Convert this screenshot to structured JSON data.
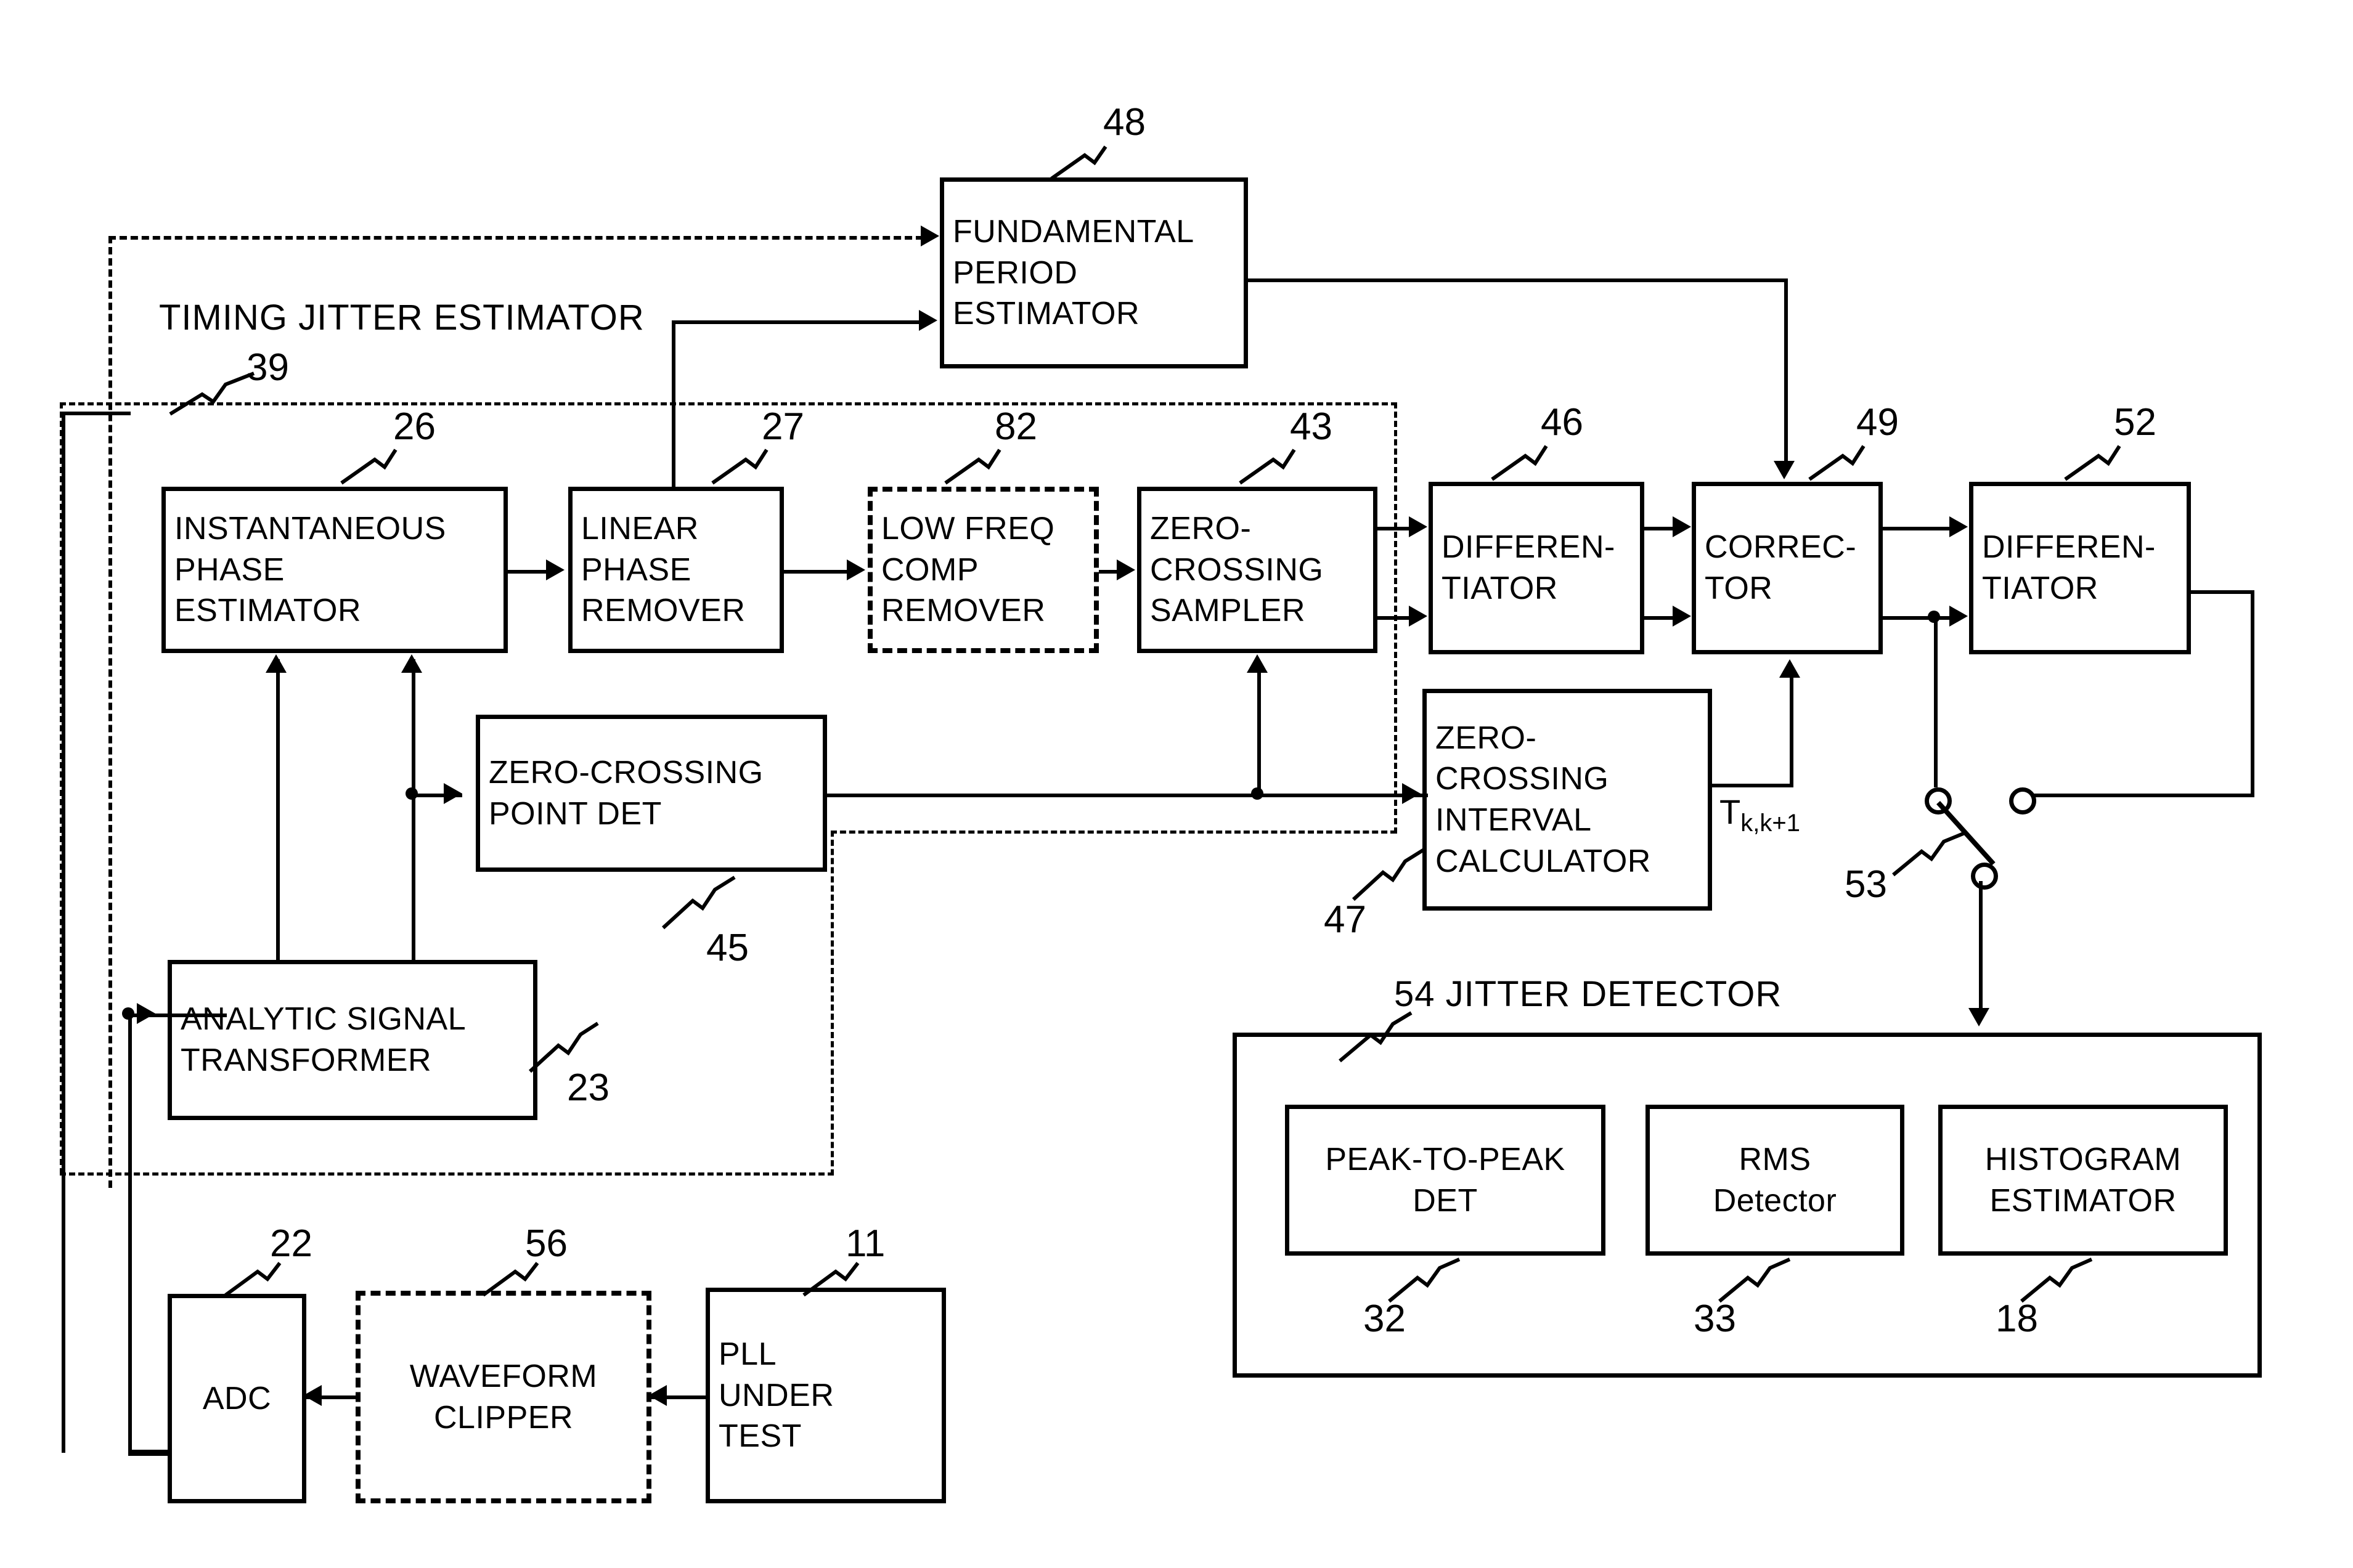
{
  "figure": {
    "type": "block-diagram",
    "domain": "patent-figure",
    "group_labels": {
      "timing_jitter_estimator": "TIMING JITTER ESTIMATOR",
      "timing_jitter_estimator_ref": "39",
      "jitter_detector": "54 JITTER DETECTOR"
    },
    "signal_labels": {
      "interval": "T",
      "interval_sub": "k,k+1"
    }
  },
  "blocks": [
    {
      "id": "fundamental_period_estimator",
      "ref": "48",
      "lines": [
        "FUNDAMENTAL",
        "PERIOD",
        "ESTIMATOR"
      ],
      "style": "solid"
    },
    {
      "id": "instantaneous_phase_estimator",
      "ref": "26",
      "lines": [
        "INSTANTANEOUS",
        "PHASE",
        "ESTIMATOR"
      ],
      "style": "solid"
    },
    {
      "id": "linear_phase_remover",
      "ref": "27",
      "lines": [
        "LINEAR",
        "PHASE",
        "REMOVER"
      ],
      "style": "solid"
    },
    {
      "id": "low_freq_comp_remover",
      "ref": "82",
      "lines": [
        "LOW FREQ",
        "COMP",
        "REMOVER"
      ],
      "style": "dashed"
    },
    {
      "id": "zero_crossing_sampler",
      "ref": "43",
      "lines": [
        "ZERO-",
        "CROSSING",
        "SAMPLER"
      ],
      "style": "solid"
    },
    {
      "id": "differentiator_46",
      "ref": "46",
      "lines": [
        "DIFFEREN-",
        "TIATOR"
      ],
      "style": "solid"
    },
    {
      "id": "corrector",
      "ref": "49",
      "lines": [
        "CORREC-",
        "TOR"
      ],
      "style": "solid"
    },
    {
      "id": "differentiator_52",
      "ref": "52",
      "lines": [
        "DIFFEREN-",
        "TIATOR"
      ],
      "style": "solid"
    },
    {
      "id": "zero_crossing_point_det",
      "ref": "45",
      "lines": [
        "ZERO-CROSSING",
        "POINT DET"
      ],
      "style": "solid"
    },
    {
      "id": "zero_crossing_interval_calculator",
      "ref": "47",
      "lines": [
        "ZERO-",
        "CROSSING",
        "INTERVAL",
        "CALCULATOR"
      ],
      "style": "solid"
    },
    {
      "id": "analytic_signal_transformer",
      "ref": "23",
      "lines": [
        "ANALYTIC SIGNAL",
        "TRANSFORMER"
      ],
      "style": "solid"
    },
    {
      "id": "adc",
      "ref": "22",
      "lines": [
        "ADC"
      ],
      "style": "solid"
    },
    {
      "id": "waveform_clipper",
      "ref": "56",
      "lines": [
        "WAVEFORM",
        "CLIPPER"
      ],
      "style": "dashed"
    },
    {
      "id": "pll_under_test",
      "ref": "11",
      "lines": [
        "PLL",
        "UNDER",
        "TEST"
      ],
      "style": "solid"
    },
    {
      "id": "peak_to_peak_det",
      "ref": "32",
      "lines": [
        "PEAK-TO-PEAK",
        "DET"
      ],
      "style": "solid"
    },
    {
      "id": "rms_detector",
      "ref": "33",
      "lines": [
        "RMS",
        "Detector"
      ],
      "style": "solid"
    },
    {
      "id": "histogram_estimator",
      "ref": "18",
      "lines": [
        "HISTOGRAM",
        "ESTIMATOR"
      ],
      "style": "solid"
    }
  ],
  "refs": {
    "switch": "53"
  },
  "text": {
    "b48_l1": "FUNDAMENTAL",
    "b48_l2": "PERIOD",
    "b48_l3": "ESTIMATOR",
    "b26_l1": "INSTANTANEOUS",
    "b26_l2": "PHASE",
    "b26_l3": "ESTIMATOR",
    "b27_l1": "LINEAR",
    "b27_l2": "PHASE",
    "b27_l3": "REMOVER",
    "b82_l1": "LOW FREQ",
    "b82_l2": "COMP",
    "b82_l3": "REMOVER",
    "b43_l1": "ZERO-",
    "b43_l2": "CROSSING",
    "b43_l3": "SAMPLER",
    "b46_l1": "DIFFEREN-",
    "b46_l2": "TIATOR",
    "b49_l1": "CORREC-",
    "b49_l2": "TOR",
    "b52_l1": "DIFFEREN-",
    "b52_l2": "TIATOR",
    "b45_l1": "ZERO-CROSSING",
    "b45_l2": "POINT DET",
    "b47_l1": "ZERO-",
    "b47_l2": "CROSSING",
    "b47_l3": "INTERVAL",
    "b47_l4": "CALCULATOR",
    "b23_l1": "ANALYTIC SIGNAL",
    "b23_l2": "TRANSFORMER",
    "b22_l1": "ADC",
    "b56_l1": "WAVEFORM",
    "b56_l2": "CLIPPER",
    "b11_l1": "PLL",
    "b11_l2": "UNDER",
    "b11_l3": "TEST",
    "b32_l1": "PEAK-TO-PEAK",
    "b32_l2": "DET",
    "b33_l1": "RMS",
    "b33_l2": "Detector",
    "b18_l1": "HISTOGRAM",
    "b18_l2": "ESTIMATOR",
    "r48": "48",
    "r26": "26",
    "r27": "27",
    "r82": "82",
    "r43": "43",
    "r46": "46",
    "r49": "49",
    "r52": "52",
    "r45": "45",
    "r47": "47",
    "r23": "23",
    "r22": "22",
    "r56": "56",
    "r11": "11",
    "r32": "32",
    "r33": "33",
    "r18": "18",
    "r53": "53",
    "r39": "39",
    "tje_title": "TIMING JITTER ESTIMATOR",
    "jd_title": "54 JITTER DETECTOR",
    "tkk_main": "T",
    "tkk_sub": "k,k+1"
  }
}
